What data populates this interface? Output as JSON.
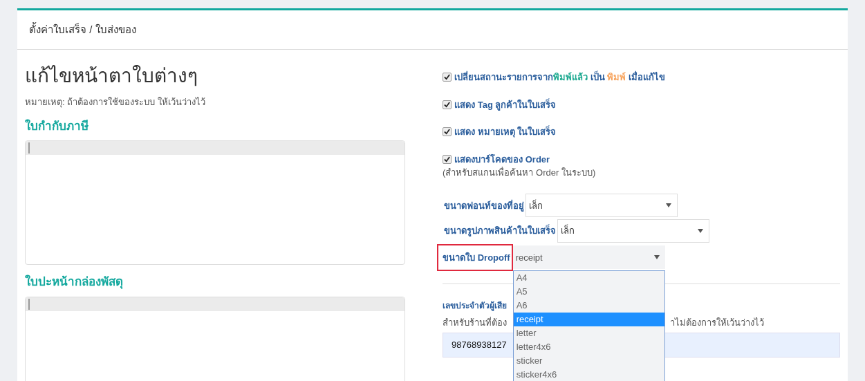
{
  "header": {
    "title": "ตั้งค่าใบเสร็จ / ใบส่งของ"
  },
  "left": {
    "title": "แก้ไขหน้าตาใบต่างๆ",
    "note": "หมายเหตุ: ถ้าต้องการใช้ของระบบ ให้เว้นว่างไว้",
    "sections": [
      {
        "heading": "ใบกำกับภาษี"
      },
      {
        "heading": "ใบปะหน้ากล่องพัสดุ"
      }
    ]
  },
  "options": [
    {
      "checked": true,
      "parts": [
        {
          "text": "เปลี่ยนสถานะรายการจาก"
        },
        {
          "text": "พิมพ์แล้ว",
          "color": "#1aa88f"
        },
        {
          "text": " เป็น "
        },
        {
          "text": "พิมพ์",
          "color": "#f7a35c"
        },
        {
          "text": " เมื่อแก้ไข"
        }
      ]
    },
    {
      "checked": true,
      "parts": [
        {
          "text": "แสดง Tag ลูกค้าในใบเสร็จ"
        }
      ]
    },
    {
      "checked": true,
      "parts": [
        {
          "text": "แสดง หมายเหตุ ในใบเสร็จ"
        }
      ]
    },
    {
      "checked": true,
      "parts": [
        {
          "text": "แสดงบาร์โคดของ Order"
        }
      ],
      "sub": "(สำหรับสแกนเพื่อค้นหา Order ในระบบ)"
    }
  ],
  "selects": [
    {
      "label": "ขนาดฟอนท์ของที่อยู่",
      "value": "เล็ก",
      "highlighted": false,
      "open": false
    },
    {
      "label": "ขนาดรูปภาพสินค้าในใบเสร็จ",
      "value": "เล็ก",
      "highlighted": false,
      "open": false
    },
    {
      "label": "ขนาดใบ Dropoff",
      "value": "receipt",
      "highlighted": true,
      "open": true,
      "options": [
        {
          "label": "A4",
          "selected": false
        },
        {
          "label": "A5",
          "selected": false
        },
        {
          "label": "A6",
          "selected": false
        },
        {
          "label": "receipt",
          "selected": true
        },
        {
          "label": "letter",
          "selected": false
        },
        {
          "label": "letter4x6",
          "selected": false
        },
        {
          "label": "sticker",
          "selected": false
        },
        {
          "label": "sticker4x6",
          "selected": false
        }
      ]
    }
  ],
  "tax_id": {
    "label": "เลขประจำตัวผู้เสีย",
    "hint_start": "สำหรับร้านที่ต้อง",
    "hint_end": "าไม่ต้องการให้เว้นว่างไว้",
    "value": "98768938127"
  }
}
